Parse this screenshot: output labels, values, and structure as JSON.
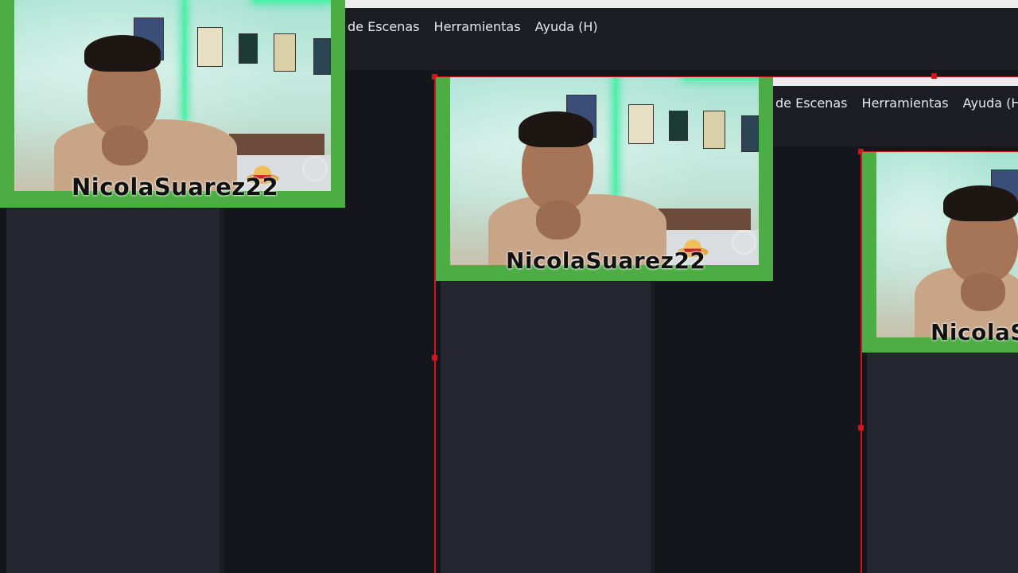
{
  "menu": {
    "primary": [
      "de Escenas",
      "Herramientas",
      "Ayuda (H)"
    ],
    "secondary": [
      "de Escenas",
      "Herramientas",
      "Ayuda (H)"
    ]
  },
  "webcam": {
    "username": "NicolaSuarez22",
    "username_cropped": "NicolaS"
  },
  "colors": {
    "frame_green": "#4dad45",
    "selection_red": "#d4141e",
    "panel_dark": "#15161b",
    "panel_column": "#25262f"
  },
  "icons": [
    "straw-hat-icon",
    "channel-logo-icon"
  ]
}
